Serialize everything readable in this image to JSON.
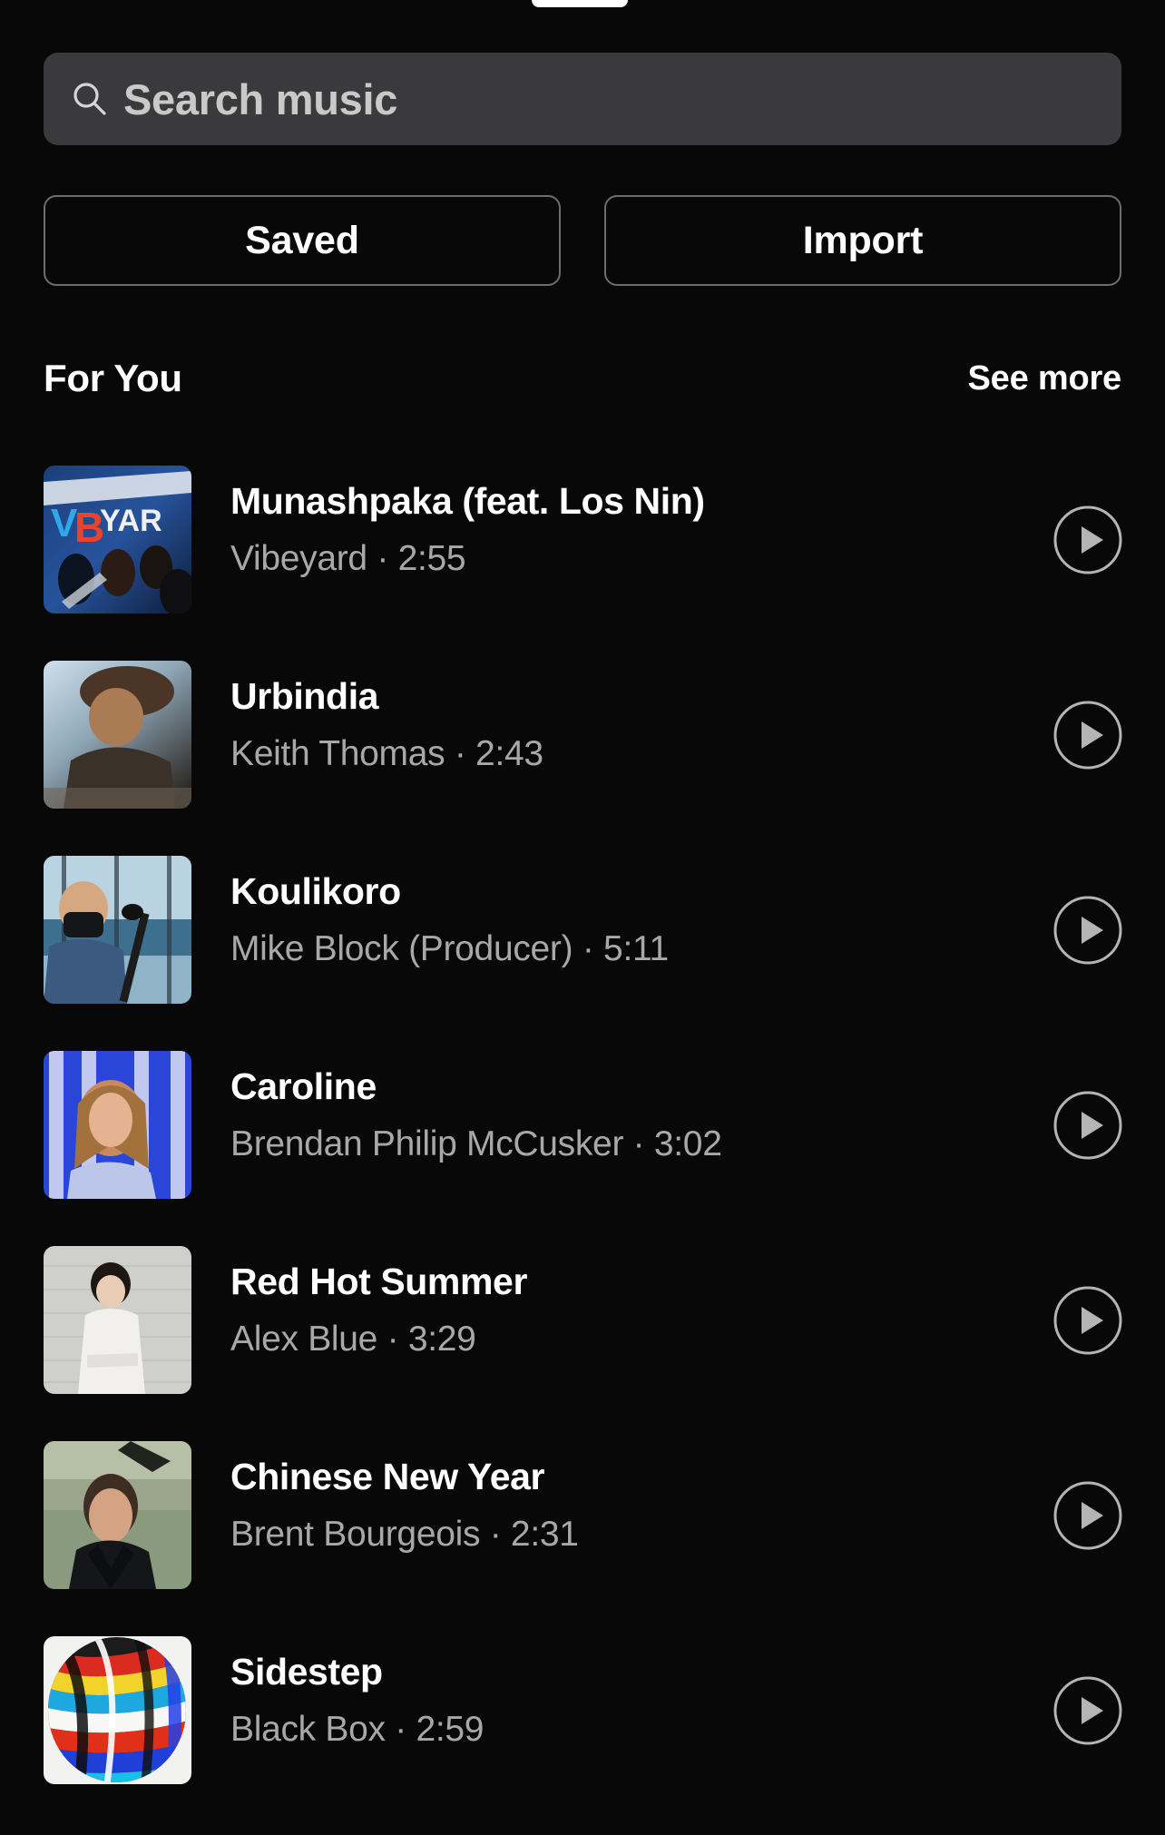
{
  "sheet": {
    "grabber": "drag-handle",
    "background": "#080808"
  },
  "search": {
    "placeholder": "Search music",
    "value": "",
    "icon": "search-icon",
    "background": "#3a3a3c",
    "placeholder_color": "#c9c9c9"
  },
  "chips": [
    {
      "label": "Saved",
      "name": "saved-button"
    },
    {
      "label": "Import",
      "name": "import-button"
    }
  ],
  "section": {
    "title": "For You",
    "see_more": "See more"
  },
  "tracks": [
    {
      "title": "Munashpaka (feat. Los Nin)",
      "artist": "Vibeyard",
      "duration": "2:55",
      "meta": "Vibeyard · 2:55",
      "artwork": "band-graffiti-blue",
      "action": "play-icon"
    },
    {
      "title": "Urbindia",
      "artist": "Keith Thomas",
      "duration": "2:43",
      "meta": "Keith Thomas · 2:43",
      "artwork": "man-cap-sunset",
      "action": "play-icon"
    },
    {
      "title": "Koulikoro",
      "artist": "Mike Block (Producer)",
      "duration": "5:11",
      "meta": "Mike Block (Producer) · 5:11",
      "artwork": "cellist-masked-window",
      "action": "play-icon"
    },
    {
      "title": "Caroline",
      "artist": "Brendan Philip McCusker",
      "duration": "3:02",
      "meta": "Brendan Philip McCusker · 3:02",
      "artwork": "long-hair-blue-backdrop",
      "action": "play-icon"
    },
    {
      "title": "Red Hot Summer",
      "artist": "Alex Blue",
      "duration": "3:29",
      "meta": "Alex Blue · 3:29",
      "artwork": "person-white-wall",
      "action": "play-icon"
    },
    {
      "title": "Chinese New Year",
      "artist": "Brent Bourgeois",
      "duration": "2:31",
      "meta": "Brent Bourgeois · 2:31",
      "artwork": "portrait-indoor-green",
      "action": "play-icon"
    },
    {
      "title": "Sidestep",
      "artist": "Black Box",
      "duration": "2:59",
      "meta": "Black Box · 2:59",
      "artwork": "abstract-paint-swirl",
      "action": "play-icon"
    }
  ],
  "colors": {
    "background": "#080808",
    "search_field": "#3a3a3c",
    "chip_border": "#6d6d6d",
    "primary_text": "#ffffff",
    "secondary_text": "#a8a8a8",
    "play_icon": "#b4b4b4"
  }
}
